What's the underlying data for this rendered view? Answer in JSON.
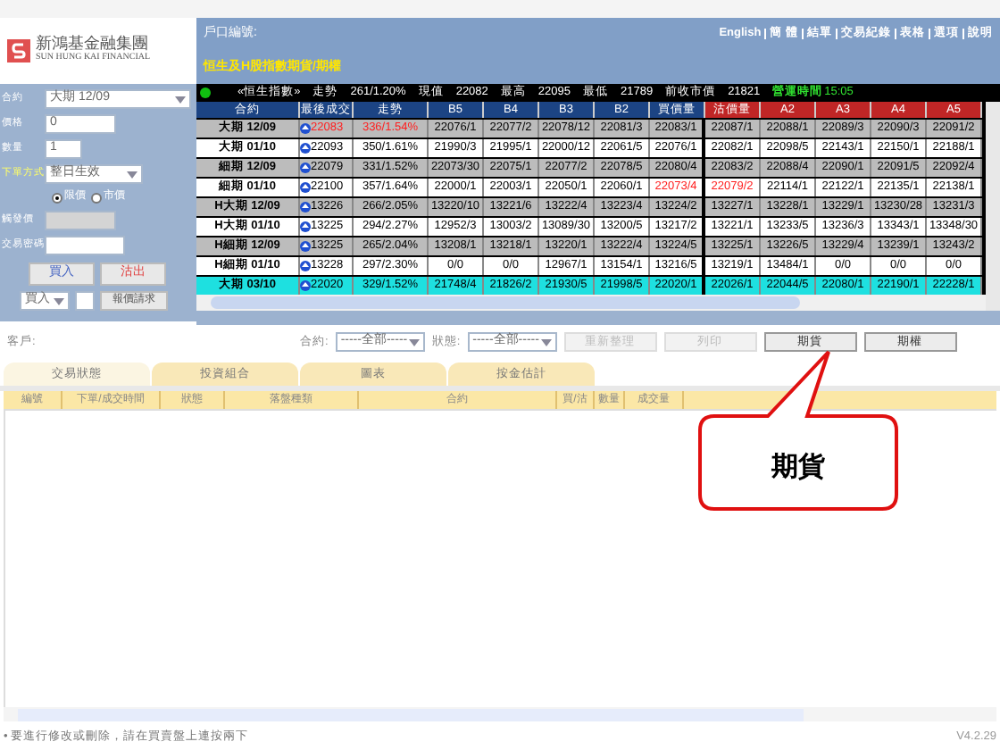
{
  "logo": {
    "chinese": "新鴻基金融集團",
    "english": "SUN HUNG KAI FINANCIAL"
  },
  "header": {
    "account_label": "戶口編號:",
    "title": "恒生及H股指數期貨/期權",
    "links": [
      "English",
      "簡 體",
      "結單",
      "交易紀錄",
      "表格",
      "選項",
      "說明"
    ]
  },
  "order_form": {
    "contract": {
      "label": "合約",
      "value": "大期 12/09"
    },
    "price": {
      "label": "價格",
      "value": "0"
    },
    "quantity": {
      "label": "數量",
      "value": "1"
    },
    "order_type": {
      "label": "下單方式",
      "value": "整日生效"
    },
    "price_types": [
      {
        "label": "限價",
        "selected": true
      },
      {
        "label": "市價",
        "selected": false
      }
    ],
    "trigger": {
      "label": "觸發價",
      "disabled": true
    },
    "password": {
      "label": "交易密碼"
    },
    "buy_button": "買入",
    "sell_button": "沽出",
    "side_select": "買入",
    "quote_button": "報價請求"
  },
  "quote_bar": {
    "index": "«恒生指數»",
    "trend_label": "走勢",
    "trend": "261/1.20%",
    "current_label": "現值",
    "current": "22082",
    "high_label": "最高",
    "high": "22095",
    "low_label": "最低",
    "low": "21789",
    "prev_label": "前收市價",
    "prev": "21821",
    "time_label": "營運時間",
    "time": "15:05"
  },
  "quotes": {
    "columns": [
      "合約",
      "最後成交",
      "走勢",
      "B5",
      "B4",
      "B3",
      "B2",
      "買價量",
      "沽價量",
      "A2",
      "A3",
      "A4",
      "A5"
    ],
    "rows": [
      {
        "contract": "大期 12/09",
        "last": "22083",
        "change": "336/1.54%",
        "bids": [
          "22076/1",
          "22077/2",
          "22078/12",
          "22081/3",
          "22083/1"
        ],
        "asks": [
          "22087/1",
          "22088/1",
          "22089/3",
          "22090/3",
          "22091/2"
        ],
        "last_red": true,
        "change_red": true,
        "bid_red": false,
        "ask_red": false,
        "selected": false
      },
      {
        "contract": "大期 01/10",
        "last": "22093",
        "change": "350/1.61%",
        "bids": [
          "21990/3",
          "21995/1",
          "22000/12",
          "22061/5",
          "22076/1"
        ],
        "asks": [
          "22082/1",
          "22098/5",
          "22143/1",
          "22150/1",
          "22188/1"
        ],
        "last_red": false,
        "change_red": false,
        "bid_red": false,
        "ask_red": false,
        "selected": false
      },
      {
        "contract": "細期 12/09",
        "last": "22079",
        "change": "331/1.52%",
        "bids": [
          "22073/30",
          "22075/1",
          "22077/2",
          "22078/5",
          "22080/4"
        ],
        "asks": [
          "22083/2",
          "22088/4",
          "22090/1",
          "22091/5",
          "22092/4"
        ],
        "last_red": false,
        "change_red": false,
        "bid_red": false,
        "ask_red": false,
        "selected": false
      },
      {
        "contract": "細期 01/10",
        "last": "22100",
        "change": "357/1.64%",
        "bids": [
          "22000/1",
          "22003/1",
          "22050/1",
          "22060/1",
          "22073/4"
        ],
        "asks": [
          "22079/2",
          "22114/1",
          "22122/1",
          "22135/1",
          "22138/1"
        ],
        "last_red": false,
        "change_red": false,
        "bid_red": true,
        "ask_red": true,
        "selected": false
      },
      {
        "contract": "H大期 12/09",
        "last": "13226",
        "change": "266/2.05%",
        "bids": [
          "13220/10",
          "13221/6",
          "13222/4",
          "13223/4",
          "13224/2"
        ],
        "asks": [
          "13227/1",
          "13228/1",
          "13229/1",
          "13230/28",
          "13231/3"
        ],
        "last_red": false,
        "change_red": false,
        "bid_red": false,
        "ask_red": false,
        "selected": false
      },
      {
        "contract": "H大期 01/10",
        "last": "13225",
        "change": "294/2.27%",
        "bids": [
          "12952/3",
          "13003/2",
          "13089/30",
          "13200/5",
          "13217/2"
        ],
        "asks": [
          "13221/1",
          "13233/5",
          "13236/3",
          "13343/1",
          "13348/30"
        ],
        "last_red": false,
        "change_red": false,
        "bid_red": false,
        "ask_red": false,
        "selected": false
      },
      {
        "contract": "H細期 12/09",
        "last": "13225",
        "change": "265/2.04%",
        "bids": [
          "13208/1",
          "13218/1",
          "13220/1",
          "13222/4",
          "13224/5"
        ],
        "asks": [
          "13225/1",
          "13226/5",
          "13229/4",
          "13239/1",
          "13243/2"
        ],
        "last_red": false,
        "change_red": false,
        "bid_red": false,
        "ask_red": false,
        "selected": false
      },
      {
        "contract": "H細期 01/10",
        "last": "13228",
        "change": "297/2.30%",
        "bids": [
          "0/0",
          "0/0",
          "12967/1",
          "13154/1",
          "13216/5"
        ],
        "asks": [
          "13219/1",
          "13484/1",
          "0/0",
          "0/0",
          "0/0"
        ],
        "last_red": false,
        "change_red": false,
        "bid_red": false,
        "ask_red": false,
        "selected": false
      },
      {
        "contract": "大期 03/10",
        "last": "22020",
        "change": "329/1.52%",
        "bids": [
          "21748/4",
          "21826/2",
          "21930/5",
          "21998/5",
          "22020/1"
        ],
        "asks": [
          "22026/1",
          "22044/5",
          "22080/1",
          "22190/1",
          "22228/1"
        ],
        "last_red": false,
        "change_red": false,
        "bid_red": false,
        "ask_red": false,
        "selected": true
      }
    ]
  },
  "filter_bar": {
    "client_label": "客戶:",
    "contract_label": "合約:",
    "contract_value": "-----全部-----",
    "status_label": "狀態:",
    "status_value": "-----全部-----",
    "buttons": [
      {
        "label": "重新整理",
        "disabled": true
      },
      {
        "label": "列印",
        "disabled": true
      },
      {
        "label": "期貨",
        "disabled": false
      },
      {
        "label": "期權",
        "disabled": false
      }
    ]
  },
  "tabs": [
    {
      "label": "交易狀態",
      "selected": true
    },
    {
      "label": "投資組合",
      "selected": false
    },
    {
      "label": "圖表",
      "selected": false
    },
    {
      "label": "按金估計",
      "selected": false
    }
  ],
  "orders": {
    "columns": [
      "編號",
      "下單/成交時間",
      "狀態",
      "落盤種類",
      "合約",
      "買/沽",
      "數量",
      "成交量"
    ]
  },
  "callout": "期貨",
  "footer": {
    "note": "• 要進行修改或刪除，請在買賣盤上連按兩下",
    "version": "V4.2.29"
  }
}
